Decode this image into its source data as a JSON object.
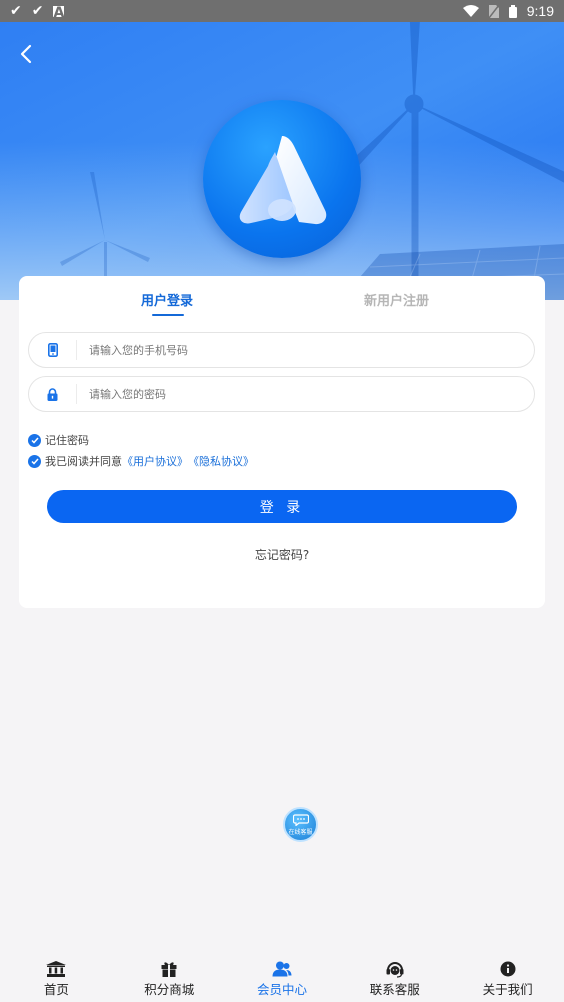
{
  "status_bar": {
    "time": "9:19"
  },
  "colors": {
    "accent": "#0a66f2",
    "tab_active": "#1469d8",
    "tab_inactive": "#b6b6b6",
    "link": "#1a6fd9"
  },
  "tabs": {
    "login": "用户登录",
    "register": "新用户注册"
  },
  "form": {
    "phone_placeholder": "请输入您的手机号码",
    "password_placeholder": "请输入您的密码",
    "remember_label": "记住密码",
    "agree_prefix": "我已阅读并同意",
    "user_agreement": "《用户协议》",
    "privacy_agreement": "《隐私协议》",
    "login_button": "登 录",
    "forgot_link": "忘记密码?"
  },
  "float_service": {
    "label": "在线客服"
  },
  "bottom_nav": [
    {
      "label": "首页",
      "icon": "bank-icon"
    },
    {
      "label": "积分商城",
      "icon": "gift-icon"
    },
    {
      "label": "会员中心",
      "icon": "users-icon",
      "active": true
    },
    {
      "label": "联系客服",
      "icon": "headset-icon"
    },
    {
      "label": "关于我们",
      "icon": "info-icon"
    }
  ]
}
